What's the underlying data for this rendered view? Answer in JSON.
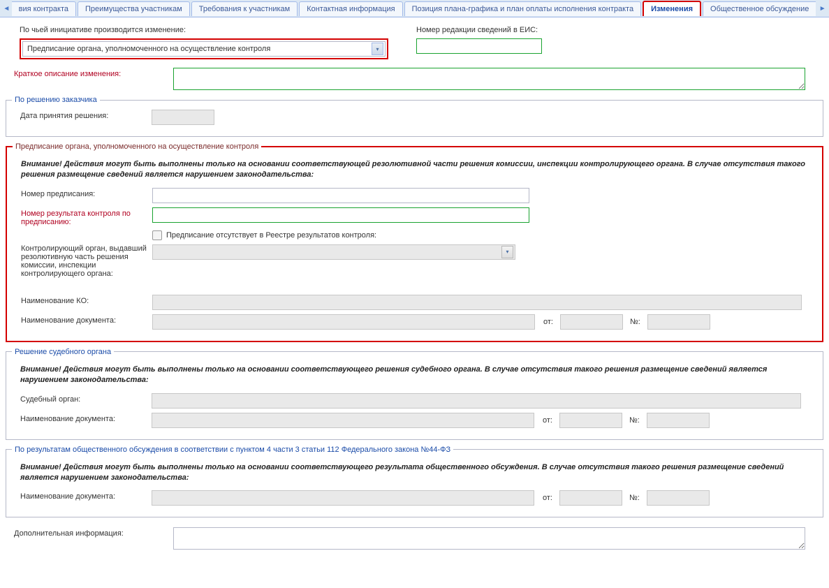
{
  "tabs": {
    "left": "вия контракта",
    "t1": "Преимущества участникам",
    "t2": "Требования к участникам",
    "t3": "Контактная информация",
    "t4": "Позиция плана-графика и план оплаты исполнения контракта",
    "t5": "Изменения",
    "t6": "Общественное обсуждение"
  },
  "top": {
    "initiative_label": "По чьей инициативе производится изменение:",
    "initiative_value": "Предписание органа, уполномоченного на осуществление контроля",
    "revision_label": "Номер редакции сведений в ЕИС:",
    "short_desc_label": "Краткое описание изменения:"
  },
  "customer": {
    "legend": "По решению заказчика",
    "date_label": "Дата принятия решения:"
  },
  "prescription": {
    "legend": "Предписание органа, уполномоченного на осуществление контроля",
    "warning": "Внимание! Действия могут быть выполнены только на основании соответствующей резолютивной части решения комиссии, инспекции контролирующего органа. В случае отсутствия такого решения размещение сведений является нарушением законодательства:",
    "number_label": "Номер предписания:",
    "result_label": "Номер результата контроля по предписанию:",
    "absent_label": "Предписание отсутствует в Реестре результатов контроля:",
    "control_body_label": "Контролирующий орган, выдавший резолютивную часть решения комиссии, инспекции контролирующего органа:",
    "ko_name_label": "Наименование КО:",
    "doc_name_label": "Наименование документа:",
    "from_label": "от:",
    "no_label": "№:"
  },
  "court": {
    "legend": "Решение судебного органа",
    "warning": "Внимание! Действия могут быть выполнены только на основании соответствующего решения судебного органа. В случае отсутствия такого решения размещение сведений является нарушением законодательства:",
    "court_label": "Судебный орган:",
    "doc_name_label": "Наименование документа:",
    "from_label": "от:",
    "no_label": "№:"
  },
  "public": {
    "legend": "По результатам общественного обсуждения в соответствии с пунктом 4 части 3 статьи 112 Федерального закона №44-ФЗ",
    "warning": "Внимание! Действия могут быть выполнены только на основании соответствующего результата общественного обсуждения. В случае отсутствия такого решения размещение сведений является нарушением законодательства:",
    "doc_name_label": "Наименование документа:",
    "from_label": "от:",
    "no_label": "№:"
  },
  "extra": {
    "label": "Дополнительная информация:"
  }
}
